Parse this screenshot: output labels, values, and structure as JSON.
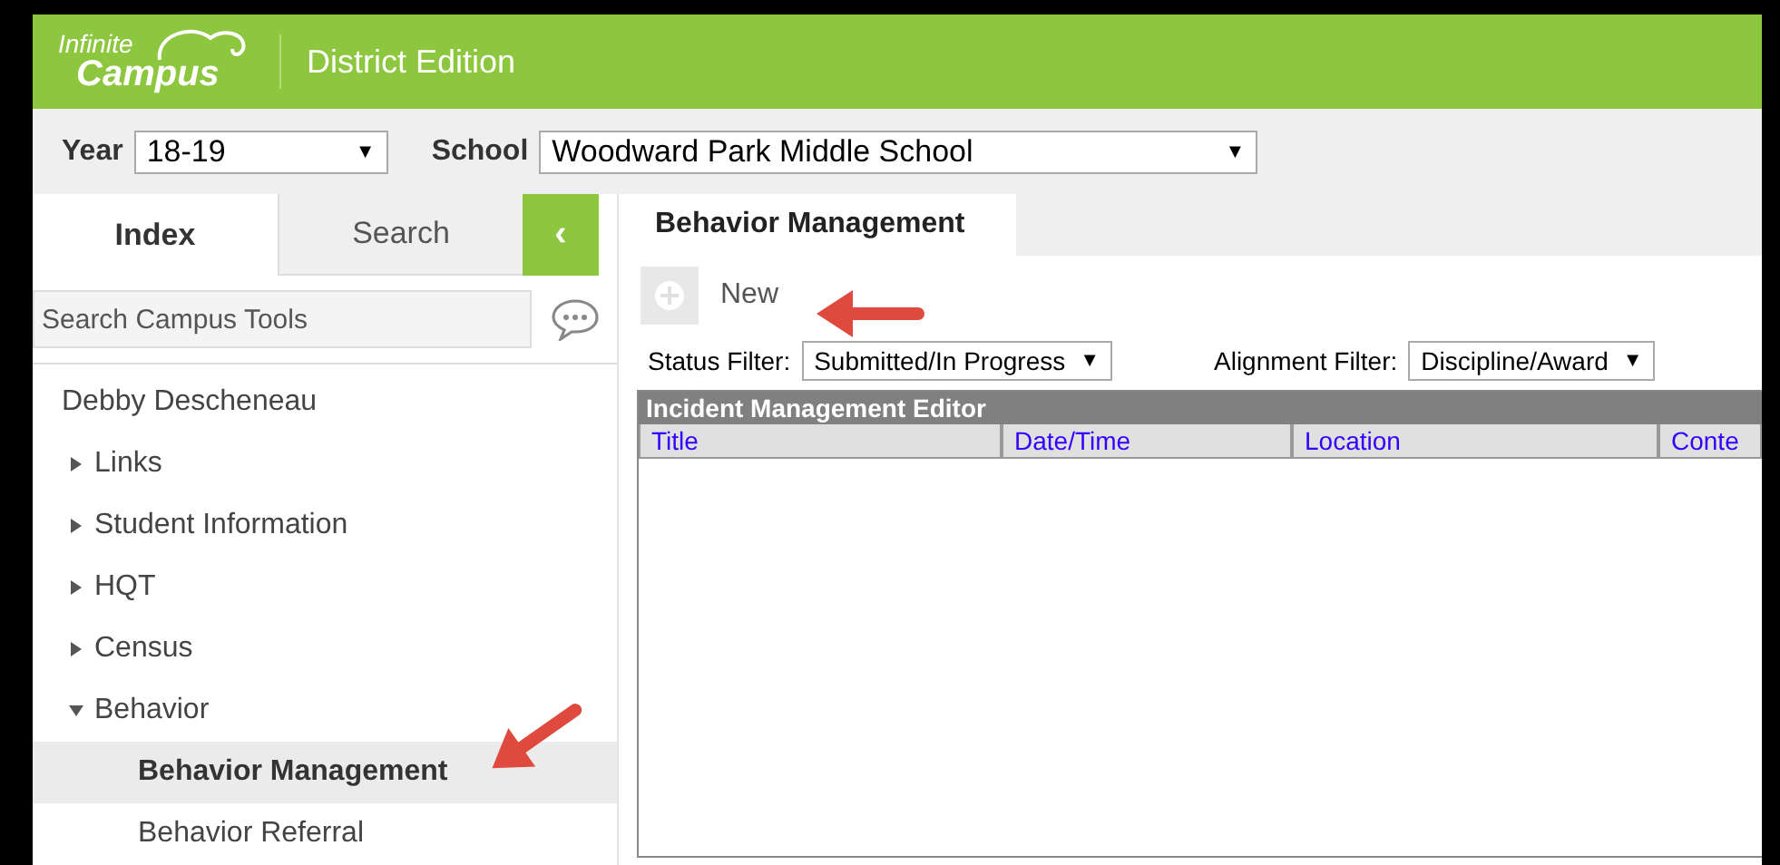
{
  "header": {
    "logo_line1": "Infinite",
    "logo_line2": "Campus",
    "title": "District Edition"
  },
  "context_bar": {
    "year_label": "Year",
    "year": "18-19",
    "school_label": "School",
    "school": "Woodward Park Middle School",
    "dropdown_glyph": "▼"
  },
  "sidebar": {
    "tabs": [
      {
        "label": "Index",
        "selected": true
      },
      {
        "label": "Search",
        "selected": false
      }
    ],
    "collapse_glyph": "‹",
    "search": {
      "placeholder": "Search Campus Tools"
    },
    "tree": {
      "label": "Debby Descheneau",
      "children": [
        {
          "label": "Links",
          "expanded": false
        },
        {
          "label": "Student Information",
          "expanded": false
        },
        {
          "label": "HQT",
          "expanded": false
        },
        {
          "label": "Census",
          "expanded": false
        },
        {
          "label": "Behavior",
          "expanded": true,
          "children": [
            {
              "label": "Behavior Management",
              "selected": true
            },
            {
              "label": "Behavior Referral",
              "selected": false
            }
          ]
        }
      ]
    }
  },
  "main": {
    "tabs": [
      {
        "label": "Behavior Management",
        "selected": true
      }
    ],
    "new_button": "New",
    "filters": [
      {
        "label": "Status Filter:",
        "value": "Submitted/In Progress"
      },
      {
        "label": "Alignment Filter:",
        "value": "Discipline/Award"
      }
    ],
    "table": {
      "title": "Incident Management Editor",
      "columns": [
        "Title",
        "Date/Time",
        "Location",
        "Conte"
      ]
    }
  }
}
